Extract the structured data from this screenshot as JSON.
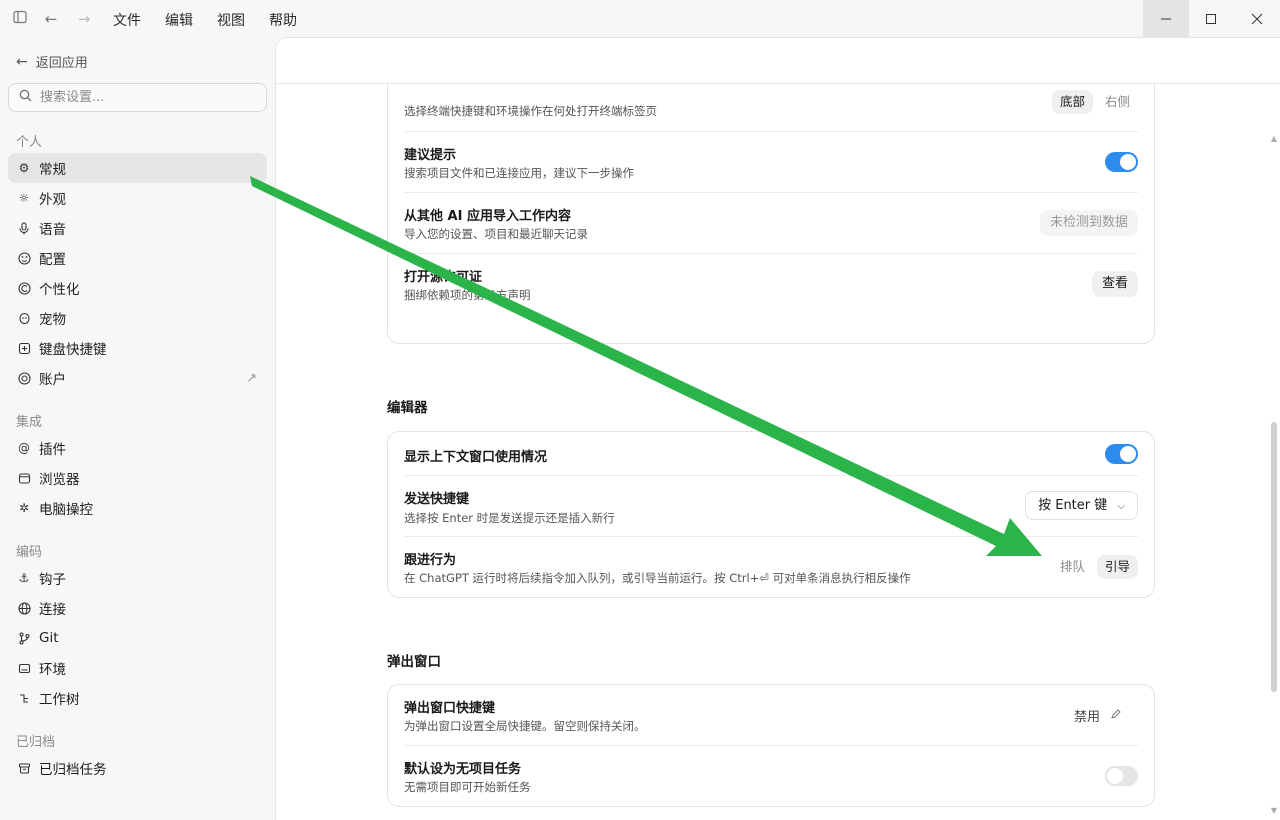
{
  "menu": {
    "file": "文件",
    "edit": "编辑",
    "view": "视图",
    "help": "帮助"
  },
  "sidebar": {
    "back_label": "返回应用",
    "search_placeholder": "搜索设置...",
    "sections": {
      "personal": "个人",
      "integration": "集成",
      "coding": "编码",
      "archived": "已归档"
    },
    "items": {
      "general": "常规",
      "appearance": "外观",
      "voice": "语音",
      "config": "配置",
      "personalization": "个性化",
      "pets": "宠物",
      "keyboard": "键盘快捷键",
      "account": "账户",
      "plugins": "插件",
      "browser": "浏览器",
      "computer_control": "电脑操控",
      "hooks": "钩子",
      "connections": "连接",
      "git": "Git",
      "environment": "环境",
      "worktree": "工作树",
      "archived_tasks": "已归档任务"
    }
  },
  "general_card": {
    "terminal": {
      "desc": "选择终端快捷键和环境操作在何处打开终端标签页",
      "opt_bottom": "底部",
      "opt_right": "右侧"
    },
    "suggestions": {
      "title": "建议提示",
      "desc": "搜索项目文件和已连接应用，建议下一步操作",
      "enabled": true
    },
    "import_ai": {
      "title": "从其他 AI 应用导入工作内容",
      "desc": "导入您的设置、项目和最近聊天记录",
      "status": "未检测到数据"
    },
    "licenses": {
      "title": "打开源许可证",
      "desc": "捆绑依赖项的第三方声明",
      "button": "查看"
    }
  },
  "editor": {
    "section_title": "编辑器",
    "context_usage": {
      "title": "显示上下文窗口使用情况",
      "enabled": true
    },
    "send_shortcut": {
      "title": "发送快捷键",
      "desc": "选择按 Enter 时是发送提示还是插入新行",
      "value": "按 Enter 键"
    },
    "follow_behavior": {
      "title": "跟进行为",
      "desc": "在 ChatGPT 运行时将后续指令加入队列，或引导当前运行。按 Ctrl+⏎ 可对单条消息执行相反操作",
      "opt_queue": "排队",
      "opt_steer": "引导"
    }
  },
  "popup": {
    "section_title": "弹出窗口",
    "shortcut": {
      "title": "弹出窗口快捷键",
      "desc": "为弹出窗口设置全局快捷键。留空则保持关闭。",
      "value": "禁用"
    },
    "no_project": {
      "title": "默认设为无项目任务",
      "desc": "无需项目即可开始新任务",
      "enabled": false
    }
  },
  "colors": {
    "accent": "#2d8cf0",
    "arrow": "#2ab44a"
  }
}
